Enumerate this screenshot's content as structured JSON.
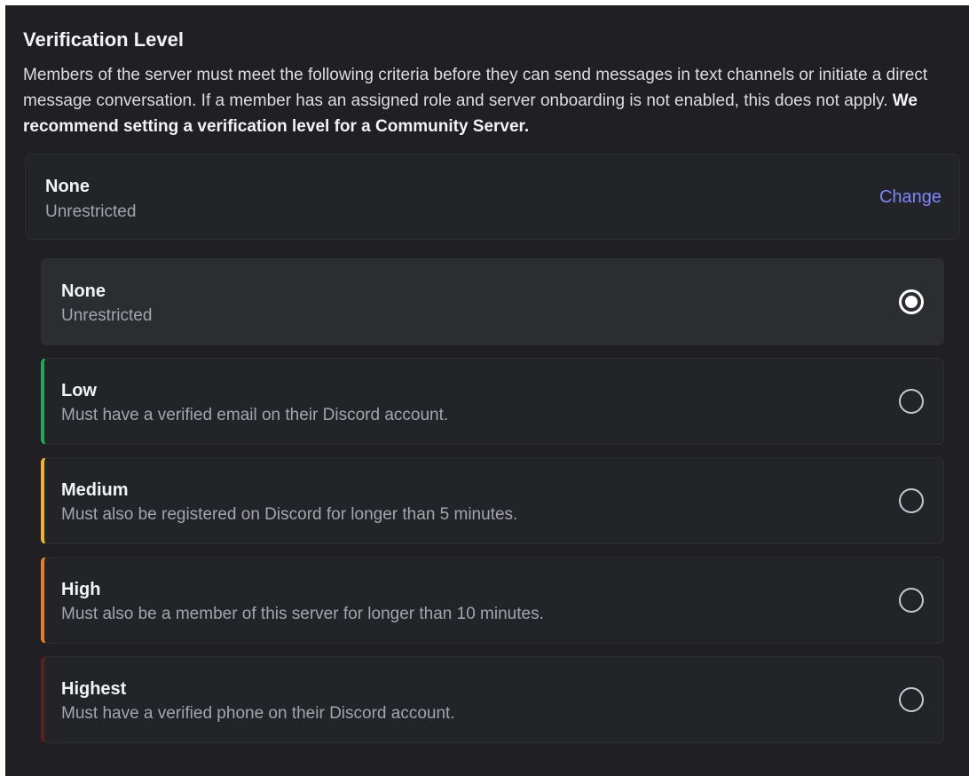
{
  "section": {
    "title": "Verification Level",
    "description": "Members of the server must meet the following criteria before they can send messages in text channels or initiate a direct message conversation. If a member has an assigned role and server onboarding is not enabled, this does not apply. ",
    "recommendation": "We recommend setting a verification level for a Community Server."
  },
  "current": {
    "label": "None",
    "description": "Unrestricted",
    "change_label": "Change"
  },
  "options": [
    {
      "label": "None",
      "description": "Unrestricted",
      "selected": true,
      "accent": "#2b2d31"
    },
    {
      "label": "Low",
      "description": "Must have a verified email on their Discord account.",
      "selected": false,
      "accent": "#23a55a"
    },
    {
      "label": "Medium",
      "description": "Must also be registered on Discord for longer than 5 minutes.",
      "selected": false,
      "accent": "#f0b232"
    },
    {
      "label": "High",
      "description": "Must also be a member of this server for longer than 10 minutes.",
      "selected": false,
      "accent": "#e67e22"
    },
    {
      "label": "Highest",
      "description": "Must have a verified phone on their Discord account.",
      "selected": false,
      "accent": "#5c1f1f"
    }
  ],
  "colors": {
    "background": "#1f1f24",
    "card": "#232428",
    "selected_card": "#2b2d31",
    "link": "#7b86ff"
  }
}
